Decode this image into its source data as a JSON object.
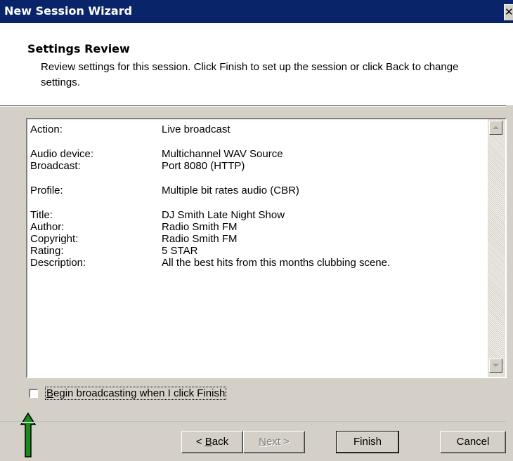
{
  "window": {
    "title": "New Session Wizard",
    "close_glyph": "✕"
  },
  "header": {
    "title": "Settings Review",
    "subtitle": "Review settings for this session. Click Finish to set up the session or click Back to change settings."
  },
  "summary": {
    "action": {
      "label": "Action:",
      "value": "Live broadcast"
    },
    "audio_device": {
      "label": "Audio device:",
      "value": "Multichannel WAV Source"
    },
    "broadcast": {
      "label": "Broadcast:",
      "value": "Port 8080 (HTTP)"
    },
    "profile": {
      "label": "Profile:",
      "value": "Multiple bit rates audio (CBR)"
    },
    "title": {
      "label": "Title:",
      "value": "DJ Smith Late Night Show"
    },
    "author": {
      "label": "Author:",
      "value": "Radio Smith FM"
    },
    "copyright": {
      "label": "Copyright:",
      "value": "Radio Smith FM"
    },
    "rating": {
      "label": "Rating:",
      "value": "5 STAR"
    },
    "description": {
      "label": "Description:",
      "value": "All the best hits from this months clubbing scene."
    }
  },
  "options": {
    "begin_broadcasting": {
      "label_accel": "B",
      "label_rest": "egin broadcasting when I click Finish",
      "checked": false
    }
  },
  "annotation": {
    "icon": "green-up-arrow-icon",
    "color": "#1a8a1a"
  },
  "buttons": {
    "back": {
      "prefix": "< ",
      "accel": "B",
      "rest": "ack"
    },
    "next": {
      "accel": "N",
      "rest": "ext >",
      "enabled": false
    },
    "finish": "Finish",
    "cancel": "Cancel"
  }
}
